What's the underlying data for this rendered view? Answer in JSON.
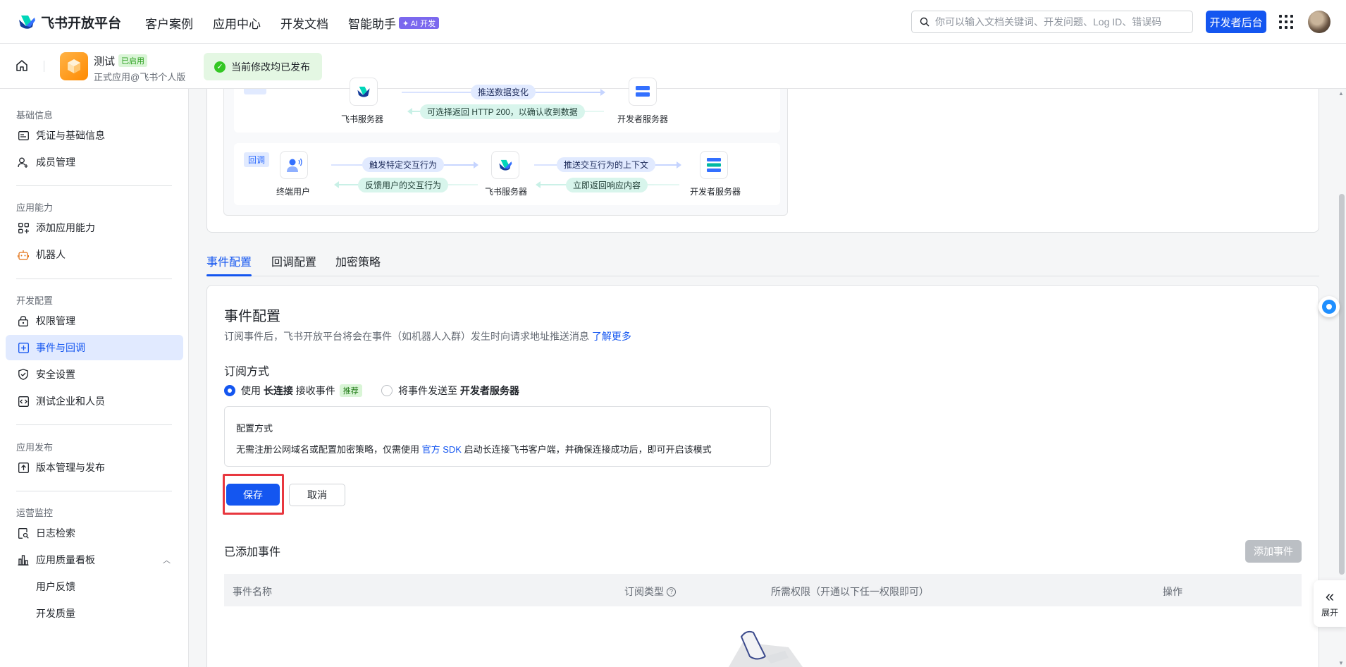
{
  "brand": {
    "name": "飞书开放平台"
  },
  "nav": {
    "links": [
      "客户案例",
      "应用中心",
      "开发文档",
      "智能助手"
    ],
    "ai_badge": "✦ AI 开发",
    "search_placeholder": "你可以输入文档关键词、开发问题、Log ID、错误码",
    "dev_console": "开发者后台"
  },
  "app": {
    "name": "测试",
    "status": "已启用",
    "subtitle": "正式应用@飞书个人版",
    "publish_notice": "当前修改均已发布"
  },
  "sidebar": {
    "groups": {
      "basic": "基础信息",
      "capability": "应用能力",
      "dev": "开发配置",
      "release": "应用发布",
      "ops": "运营监控"
    },
    "items": {
      "credentials": "凭证与基础信息",
      "members": "成员管理",
      "add_capability": "添加应用能力",
      "bot": "机器人",
      "permissions": "权限管理",
      "events": "事件与回调",
      "security": "安全设置",
      "test_tenants": "测试企业和人员",
      "versions": "版本管理与发布",
      "logs": "日志检索",
      "quality_board": "应用质量看板",
      "feedback": "用户反馈",
      "dev_quality": "开发质量"
    }
  },
  "flow": {
    "event_row": {
      "push_change": "推送数据变化",
      "return_200": "可选择返回 HTTP 200，以确认收到数据",
      "feishu_server": "飞书服务器",
      "dev_server": "开发者服务器"
    },
    "callback_row": {
      "tag": "回调",
      "end_user": "终端用户",
      "trigger": "触发特定交互行为",
      "feedback": "反馈用户的交互行为",
      "feishu_server": "飞书服务器",
      "push_context": "推送交互行为的上下文",
      "respond": "立即返回响应内容",
      "dev_server": "开发者服务器"
    }
  },
  "tabs": [
    "事件配置",
    "回调配置",
    "加密策略"
  ],
  "event_config": {
    "title": "事件配置",
    "desc": "订阅事件后，飞书开放平台将会在事件（如机器人入群）发生时向请求地址推送消息",
    "learn_more": "了解更多",
    "subscribe_title": "订阅方式",
    "option1": {
      "prefix": "使用",
      "bold": "长连接",
      "suffix": "接收事件",
      "badge": "推荐"
    },
    "option2": {
      "prefix": "将事件发送至",
      "bold": "开发者服务器"
    },
    "cfg_title": "配置方式",
    "cfg_body_pre": "无需注册公网域名或配置加密策略，仅需使用",
    "cfg_body_link": "官方 SDK",
    "cfg_body_post": "启动长连接飞书客户端，并确保连接成功后，即可开启该模式",
    "save": "保存",
    "cancel": "取消"
  },
  "added_events": {
    "title": "已添加事件",
    "add_button": "添加事件",
    "columns": [
      "事件名称",
      "订阅类型",
      "所需权限（开通以下任一权限即可）",
      "操作"
    ]
  },
  "floating": {
    "expand": "展开"
  }
}
